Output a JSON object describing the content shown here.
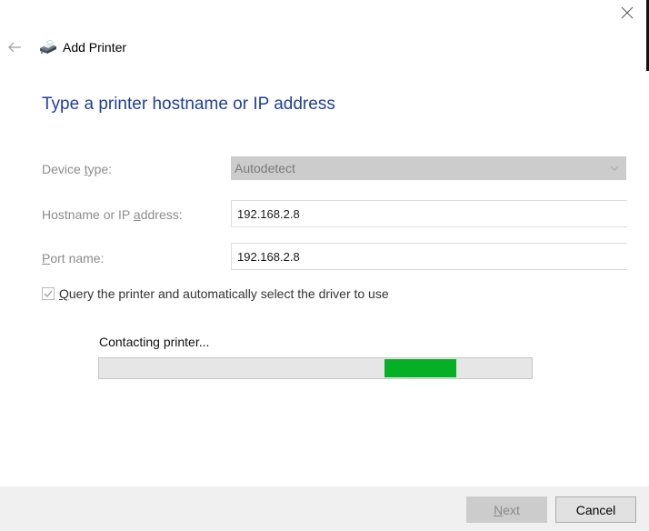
{
  "window": {
    "title": "Add Printer",
    "close_icon": "close-icon",
    "back_icon": "back-arrow-icon",
    "app_icon": "printer-icon"
  },
  "page": {
    "heading": "Type a printer hostname or IP address"
  },
  "form": {
    "device_type": {
      "label_pre": "Device ",
      "label_mnemonic": "t",
      "label_post": "ype:",
      "value": "Autodetect",
      "disabled": true
    },
    "hostname": {
      "label_pre": "Hostname or IP ",
      "label_mnemonic": "a",
      "label_post": "ddress:",
      "value": "192.168.2.8"
    },
    "port": {
      "label_pre": "",
      "label_mnemonic": "P",
      "label_post": "ort name:",
      "value": "192.168.2.8"
    },
    "query_checkbox": {
      "label_mnemonic": "Q",
      "label_post": "uery the printer and automatically select the driver to use",
      "checked": true,
      "disabled": true
    }
  },
  "progress": {
    "status": "Contacting printer...",
    "mode": "marquee",
    "segment_start_fraction": 0.66,
    "segment_width_fraction": 0.165,
    "color": "#06b025"
  },
  "footer": {
    "next_mnemonic": "N",
    "next_post": "ext",
    "next_disabled": true,
    "cancel_label": "Cancel"
  },
  "colors": {
    "heading": "#1f3f9c",
    "disabled_label": "#8c8c8c",
    "footer_bg": "#f0f0f0"
  }
}
